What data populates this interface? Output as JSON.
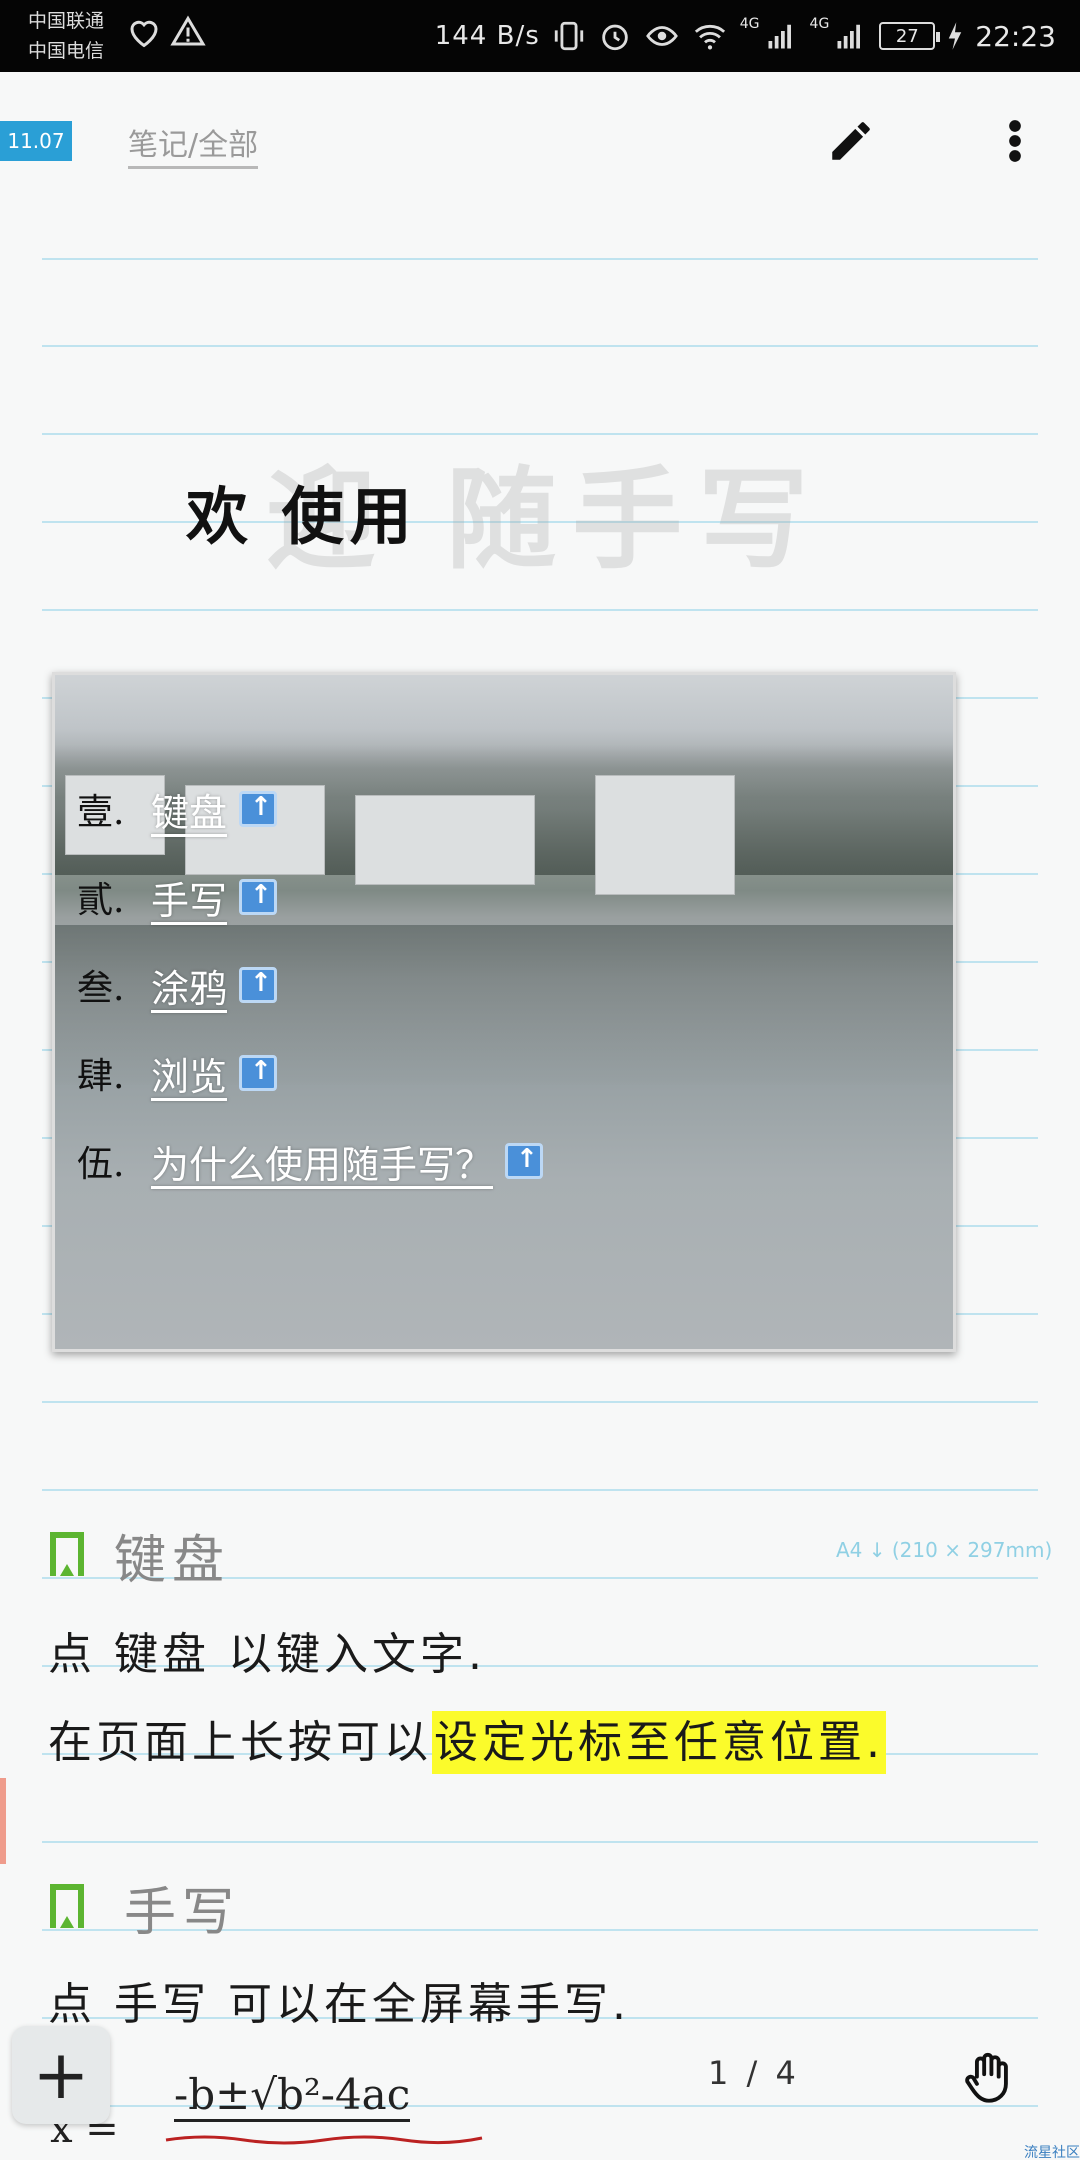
{
  "status_bar": {
    "carrier_1": "中国联通",
    "carrier_2": "中国电信",
    "speed": "144 B/s",
    "battery": "27",
    "time": "22:23",
    "net_1": "4G",
    "net_2": "4G"
  },
  "app_bar": {
    "date": "11.07",
    "breadcrumb": "笔记/全部",
    "edit_icon": "pen-icon",
    "more_icon": "more-vert-icon"
  },
  "title": {
    "plain": "欢 使用",
    "ghost": "迎 随手写"
  },
  "menu": {
    "items": [
      {
        "num": "壹.",
        "label": "键盘"
      },
      {
        "num": "貳.",
        "label": "手写"
      },
      {
        "num": "叁.",
        "label": "涂鸦"
      },
      {
        "num": "肆.",
        "label": "浏览"
      },
      {
        "num": "伍.",
        "label": "为什么使用随手写？"
      }
    ]
  },
  "paper_size": "A4 ↓ (210 × 297mm)",
  "section_keyboard": {
    "title": "键盘",
    "line_1": "点 键盘 以键入文字.",
    "line_2_plain": "在页面上长按可以",
    "line_2_highlight": "设定光标至任意位置."
  },
  "section_handwrite": {
    "title": "手写",
    "line_1": "点 手写 可以在全屏幕手写."
  },
  "formula": {
    "text": "-b±√b²-4ac",
    "lhs": "x =",
    "fab_label": "+"
  },
  "page_indicator": "1 / 4",
  "watermark": "流星社区",
  "colors": {
    "accent_blue": "#2a9fd6",
    "bookmark_green": "#5cb531",
    "highlight_yellow": "#fbfb2b",
    "rule_line": "#bfe3ef"
  }
}
